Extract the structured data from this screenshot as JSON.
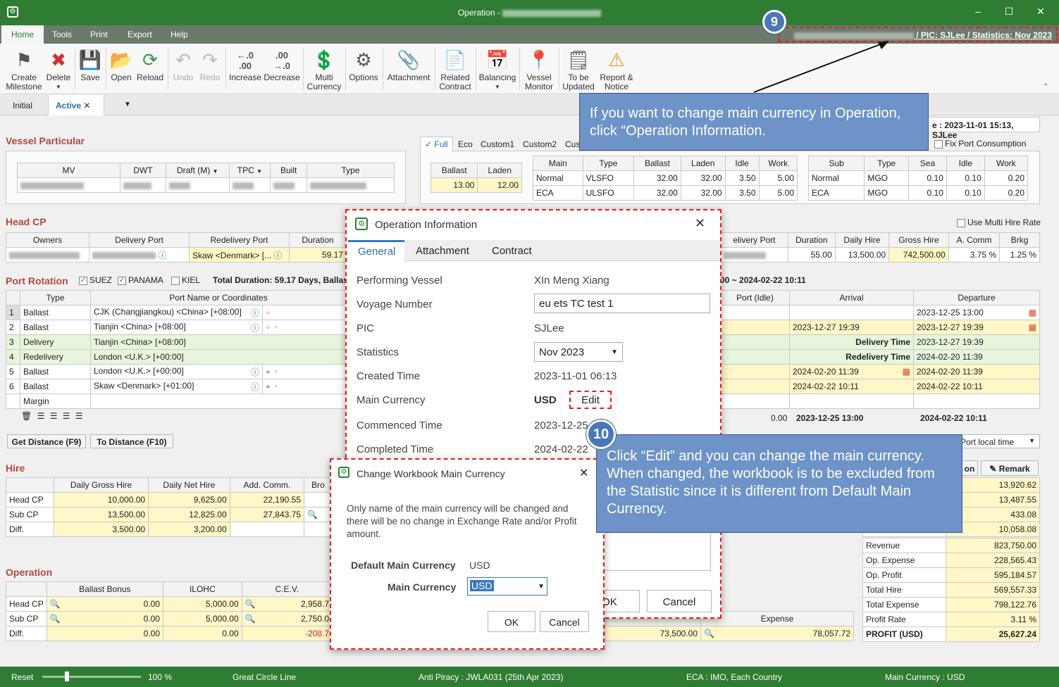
{
  "title": {
    "app": "Operation -",
    "pic": "/ PIC: SJLee / Statistics: Nov 2023"
  },
  "menu": [
    "Home",
    "Tools",
    "Print",
    "Export",
    "Help"
  ],
  "ribbon": [
    {
      "label": "Create\nMilestone",
      "icon": "milestone-icon"
    },
    {
      "label": "Delete",
      "icon": "delete-icon"
    },
    {
      "label": "Save",
      "icon": "save-icon"
    },
    {
      "label": "Open",
      "icon": "open-icon"
    },
    {
      "label": "Reload",
      "icon": "reload-icon"
    },
    {
      "label": "Undo",
      "icon": "undo-icon"
    },
    {
      "label": "Redo",
      "icon": "redo-icon"
    },
    {
      "label": "Increase",
      "icon": "increase-icon"
    },
    {
      "label": "Decrease",
      "icon": "decrease-icon"
    },
    {
      "label": "Multi\nCurrency",
      "icon": "currency-icon"
    },
    {
      "label": "Options",
      "icon": "gear-icon"
    },
    {
      "label": "Attachment",
      "icon": "paperclip-icon"
    },
    {
      "label": "Related\nContract",
      "icon": "contract-icon"
    },
    {
      "label": "Balancing",
      "icon": "calendar-icon"
    },
    {
      "label": "Vessel\nMonitor",
      "icon": "map-pin-icon"
    },
    {
      "label": "To be\nUpdated",
      "icon": "update-icon"
    },
    {
      "label": "Report &\nNotice",
      "icon": "warning-icon"
    }
  ],
  "tabs": {
    "initial": "Initial",
    "active": "Active"
  },
  "vessel": {
    "title": "Vessel Particular",
    "cols": [
      "MV",
      "DWT",
      "Draft (M)",
      "TPC",
      "Built",
      "Type"
    ]
  },
  "speed": {
    "tabs": [
      "Full",
      "Eco",
      "Custom1",
      "Custom2",
      "Cus"
    ],
    "bl": {
      "h": [
        "Ballast",
        "Laden"
      ],
      "v": [
        "13.00",
        "12.00"
      ]
    },
    "main": {
      "h": [
        "Main",
        "Type",
        "Ballast",
        "Laden",
        "Idle",
        "Work"
      ],
      "rows": [
        [
          "Normal",
          "VLSFO",
          "32.00",
          "32.00",
          "3.50",
          "5.00"
        ],
        [
          "ECA",
          "ULSFO",
          "32.00",
          "32.00",
          "3.50",
          "5.00"
        ]
      ]
    },
    "sub": {
      "h": [
        "Sub",
        "Type",
        "Sea",
        "Idle",
        "Work"
      ],
      "rows": [
        [
          "Normal",
          "MGO",
          "0.10",
          "0.10",
          "0.20"
        ],
        [
          "ECA",
          "MGO",
          "0.10",
          "0.10",
          "0.20"
        ]
      ]
    },
    "fix": "Fix Port Consumption",
    "updated": "e : 2023-11-01 15:13, SJLee"
  },
  "headcp": {
    "title": "Head CP",
    "multi": "Use Multi Hire Rate",
    "left": {
      "h": [
        "Owners",
        "Delivery Port",
        "Redelivery Port",
        "Duration"
      ],
      "v": [
        "",
        "",
        "Skaw <Denmark> [...",
        "59.17"
      ]
    },
    "right": {
      "h": [
        "elivery Port",
        "Duration",
        "Daily Hire",
        "Gross Hire",
        "A. Comm",
        "Brkg"
      ],
      "v": [
        "",
        "55.00",
        "13,500.00",
        "742,500.00",
        "3.75 %",
        "1.25 %"
      ]
    }
  },
  "rotation": {
    "title": "Port Rotation",
    "chk": [
      "SUEZ",
      "PANAMA",
      "KIEL"
    ],
    "total": "Total Duration: 59.17 Days, Ballast",
    "range": "00 ~ 2024-02-22 10:11",
    "h": [
      "Type",
      "Port Name or Coordinates"
    ],
    "rows": [
      {
        "n": "1",
        "t": "Ballast",
        "p": "CJK (Changjiangkou) <China> [+08:00]"
      },
      {
        "n": "2",
        "t": "Ballast",
        "p": "Tianjin <China> [+08:00]"
      },
      {
        "n": "3",
        "t": "Delivery",
        "p": "Tianjin <China> [+08:00]"
      },
      {
        "n": "4",
        "t": "Redelivery",
        "p": "London <U.K.> [+00:00]"
      },
      {
        "n": "5",
        "t": "Ballast",
        "p": "London <U.K.> [+00:00]"
      },
      {
        "n": "6",
        "t": "Ballast",
        "p": "Skaw <Denmark> [+01:00]"
      },
      {
        "n": "",
        "t": "Margin",
        "p": ""
      }
    ],
    "rh": [
      "Port (Idle)",
      "Arrival",
      "Departure"
    ],
    "rrows": [
      [
        "",
        "",
        "2023-12-25 13:00"
      ],
      [
        "",
        "2023-12-27 19:39",
        "2023-12-27 19:39"
      ],
      [
        "",
        "Delivery Time",
        "2023-12-27 19:39"
      ],
      [
        "",
        "Redelivery Time",
        "2024-02-20 11:39"
      ],
      [
        "",
        "2024-02-20 11:39",
        "2024-02-20 11:39"
      ],
      [
        "",
        "2024-02-22 10:11",
        "2024-02-22 10:11"
      ],
      [
        "",
        "",
        ""
      ]
    ],
    "tot": [
      "0.00",
      "2023-12-25 13:00",
      "2024-02-22 10:11"
    ],
    "getdist": "Get Distance (F9)",
    "todist": "To Distance (F10)",
    "portlocal": "Port local time"
  },
  "hire": {
    "title": "Hire",
    "h": [
      "",
      "Daily Gross Hire",
      "Daily Net Hire",
      "Add. Comm.",
      "Bro"
    ],
    "rows": [
      [
        "Head CP",
        "10,000.00",
        "9,625.00",
        "22,190.55"
      ],
      [
        "Sub CP",
        "13,500.00",
        "12,825.00",
        "27,843.75"
      ],
      [
        "Diff.",
        "3,500.00",
        "3,200.00",
        ""
      ]
    ]
  },
  "operation": {
    "title": "Operation",
    "h": [
      "",
      "Ballast Bonus",
      "ILOHC",
      "C.E.V."
    ],
    "rows": [
      [
        "Head CP",
        "0.00",
        "5,000.00",
        "2,958.7"
      ],
      [
        "Sub CP",
        "0.00",
        "5,000.00",
        "2,750.0"
      ],
      [
        "Diff.",
        "0.00",
        "0.00",
        "-208.7"
      ]
    ],
    "exp": {
      "h": "Expense",
      "a": "73,500.00",
      "b": "78,057.72"
    }
  },
  "summary": {
    "remark": "Remark",
    "on": "on",
    "top": [
      "13,920.62",
      "13,487.55",
      "433.08",
      "10,058.08"
    ],
    "rows": [
      [
        "Revenue",
        "823,750.00"
      ],
      [
        "Op. Expense",
        "228,565.43"
      ],
      [
        "Op. Profit",
        "595,184.57"
      ],
      [
        "Total Hire",
        "569,557.33"
      ],
      [
        "Total Expense",
        "798,122.76"
      ],
      [
        "Profit Rate",
        "3.11 %"
      ],
      [
        "PROFIT (USD)",
        "25,627.24"
      ]
    ]
  },
  "opinfo": {
    "title": "Operation Information",
    "tabs": [
      "General",
      "Attachment",
      "Contract"
    ],
    "fields": [
      {
        "l": "Performing Vessel",
        "v": "XIn Meng Xiang"
      },
      {
        "l": "Voyage Number",
        "v": "eu ets TC test 1"
      },
      {
        "l": "PIC",
        "v": "SJLee"
      },
      {
        "l": "Statistics",
        "v": "Nov 2023"
      },
      {
        "l": "Created Time",
        "v": "2023-11-01 06:13"
      },
      {
        "l": "Main Currency",
        "v": "USD"
      },
      {
        "l": "Commenced Time",
        "v": "2023-12-25"
      },
      {
        "l": "Completed Time",
        "v": "2024-02-22"
      }
    ],
    "edit": "Edit",
    "ok": "OK",
    "cancel": "Cancel"
  },
  "change": {
    "title": "Change Workbook Main Currency",
    "msg": "Only name of the main currency will be changed and there will be no change in Exchange Rate and/or Profit amount.",
    "defl": "Default Main Currency",
    "defv": "USD",
    "mainl": "Main Currency",
    "mainv": "USD",
    "ok": "OK",
    "cancel": "Cancel"
  },
  "callout1": {
    "num": "9",
    "text": "If you want to change main currency in Operation, click “Operation Information."
  },
  "callout2": {
    "num": "10",
    "text": "Click “Edit” and you can change the main currency. When changed, the workbook is to be excluded from the Statistic since it is different from Default Main Currency."
  },
  "status": {
    "reset": "Reset",
    "zoom": "100 %",
    "gc": "Great Circle Line",
    "ap": "Anti Piracy : JWLA031 (25th Apr 2023)",
    "eca": "ECA : IMO, Each Country",
    "mc": "Main Currency : USD"
  }
}
